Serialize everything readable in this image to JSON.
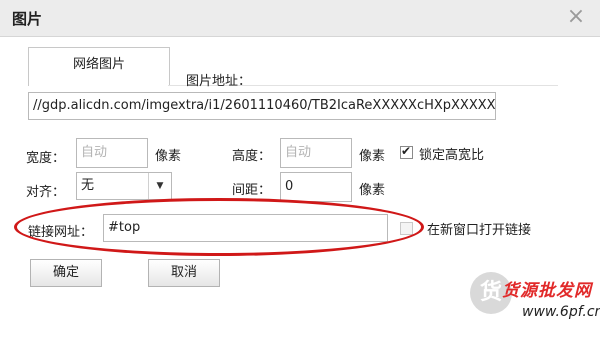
{
  "dialog": {
    "title": "图片",
    "close_glyph": "×",
    "close_icon": "close-icon"
  },
  "tabs": [
    {
      "label": "网络图片",
      "active": true
    }
  ],
  "image_url": {
    "label": "图片地址：",
    "value": "//gdp.alicdn.com/imgextra/i1/2601110460/TB2IcaReXXXXXcHXpXXXXX"
  },
  "width": {
    "label": "宽度：",
    "placeholder": "自动",
    "unit": "像素"
  },
  "height": {
    "label": "高度：",
    "placeholder": "自动",
    "unit": "像素"
  },
  "lock_ratio": {
    "label": "锁定高宽比",
    "checked": true
  },
  "align": {
    "label": "对齐：",
    "value": "无",
    "arrow_icon": "dropdown-arrow-icon"
  },
  "spacing": {
    "label": "间距：",
    "value": "0",
    "unit": "像素"
  },
  "link": {
    "label": "链接网址：",
    "value": "#top"
  },
  "new_window": {
    "label": "在新窗口打开链接",
    "checked": false
  },
  "buttons": {
    "ok": "确定",
    "cancel": "取消"
  },
  "watermark": {
    "text": "货源批发网",
    "url": "www.6pf.cn",
    "color": "#e12a2a"
  },
  "highlight_color": "#d01818"
}
